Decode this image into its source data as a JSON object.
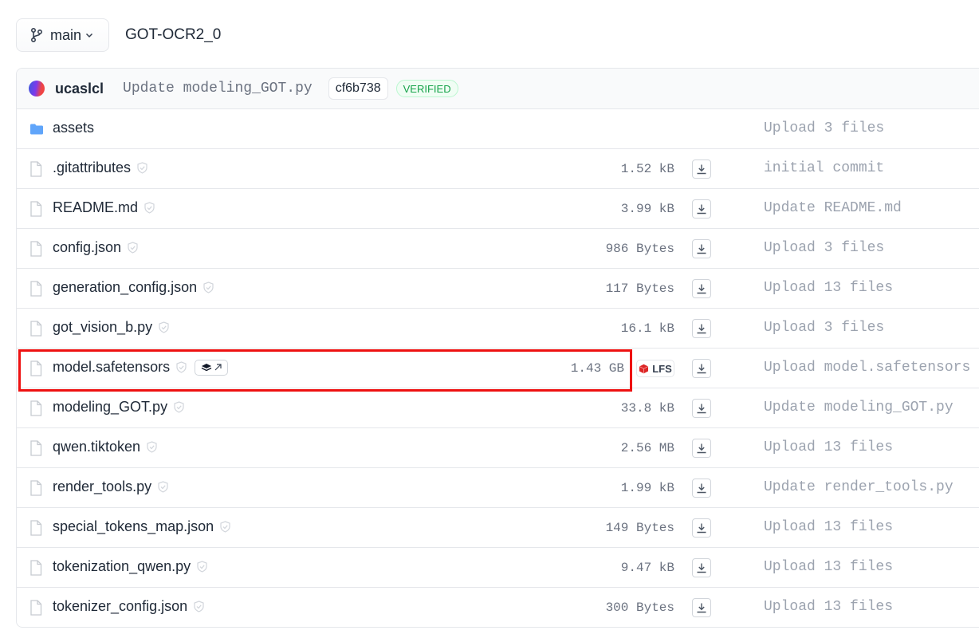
{
  "header": {
    "branch_label": "main",
    "repo_name": "GOT-OCR2_0"
  },
  "commit": {
    "author": "ucaslcl",
    "message": "Update modeling_GOT.py",
    "hash": "cf6b738",
    "verified_label": "VERIFIED"
  },
  "files": [
    {
      "name": "assets",
      "type": "folder",
      "size": "",
      "lfs": false,
      "commit": "Upload 3 files"
    },
    {
      "name": ".gitattributes",
      "type": "file",
      "size": "1.52 kB",
      "lfs": false,
      "commit": "initial commit"
    },
    {
      "name": "README.md",
      "type": "file",
      "size": "3.99 kB",
      "lfs": false,
      "commit": "Update README.md"
    },
    {
      "name": "config.json",
      "type": "file",
      "size": "986 Bytes",
      "lfs": false,
      "commit": "Upload 3 files"
    },
    {
      "name": "generation_config.json",
      "type": "file",
      "size": "117 Bytes",
      "lfs": false,
      "commit": "Upload 13 files"
    },
    {
      "name": "got_vision_b.py",
      "type": "file",
      "size": "16.1 kB",
      "lfs": false,
      "commit": "Upload 3 files"
    },
    {
      "name": "model.safetensors",
      "type": "file",
      "size": "1.43 GB",
      "lfs": true,
      "lfs_label": "LFS",
      "commit": "Upload model.safetensors"
    },
    {
      "name": "modeling_GOT.py",
      "type": "file",
      "size": "33.8 kB",
      "lfs": false,
      "commit": "Update modeling_GOT.py"
    },
    {
      "name": "qwen.tiktoken",
      "type": "file",
      "size": "2.56 MB",
      "lfs": false,
      "commit": "Upload 13 files"
    },
    {
      "name": "render_tools.py",
      "type": "file",
      "size": "1.99 kB",
      "lfs": false,
      "commit": "Update render_tools.py"
    },
    {
      "name": "special_tokens_map.json",
      "type": "file",
      "size": "149 Bytes",
      "lfs": false,
      "commit": "Upload 13 files"
    },
    {
      "name": "tokenization_qwen.py",
      "type": "file",
      "size": "9.47 kB",
      "lfs": false,
      "commit": "Upload 13 files"
    },
    {
      "name": "tokenizer_config.json",
      "type": "file",
      "size": "300 Bytes",
      "lfs": false,
      "commit": "Upload 13 files"
    }
  ],
  "icons": {
    "branch": "git-branch-icon",
    "folder": "folder-icon",
    "file": "file-icon",
    "shield": "shield-icon",
    "download": "download-icon",
    "lfs": "lfs-cube-icon",
    "external": "stack-external-link-icon"
  },
  "colors": {
    "folder": "#60a5fa",
    "verified": "#16a34a",
    "lfs_cube": "#dc2626",
    "highlight": "#ee1111"
  }
}
